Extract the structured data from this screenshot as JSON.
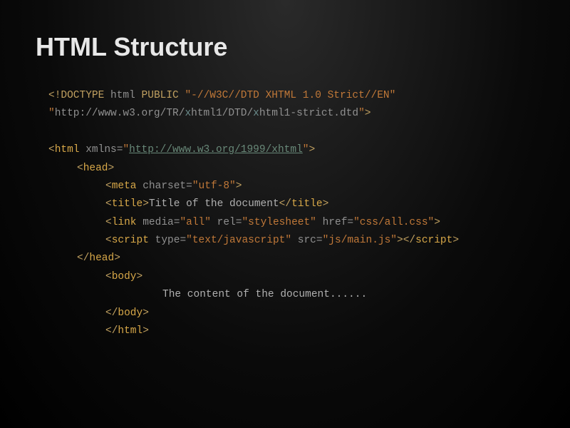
{
  "title": "HTML Structure",
  "code": {
    "doctype_open": "<!",
    "doctype_kw": "DOCTYPE",
    "doctype_sp1": " html ",
    "doctype_public": "PUBLIC",
    "doctype_sp2": " ",
    "doctype_fpi": "\"-//W3C//DTD XHTML 1.0 Strict//EN\"",
    "doctype_url_q1": "\"",
    "doctype_url_pre": "http://www.w3.org/TR/",
    "doctype_url_x1": "x",
    "doctype_url_mid1": "html1/DTD/",
    "doctype_url_x2": "x",
    "doctype_url_mid2": "html1-strict.dtd",
    "doctype_url_q2": "\"",
    "doctype_close": ">",
    "html_open_lt": "<",
    "html_tag": "html",
    "html_sp": " ",
    "html_xmlns": "xmlns",
    "html_eq": "=",
    "html_q1": "\"",
    "html_url": "http://www.w3.org/1999/xhtml",
    "html_q2": "\"",
    "html_gt": ">",
    "head_open": "<",
    "head_tag": "head",
    "head_gt": ">",
    "meta_open": "<",
    "meta_tag": "meta",
    "meta_sp": " ",
    "meta_attr": "charset",
    "meta_eq": "=",
    "meta_val": "\"utf-8\"",
    "meta_gt": ">",
    "title_open": "<",
    "title_tag": "title",
    "title_gt": ">",
    "title_text": "Title of the document",
    "title_close_open": "</",
    "title_close_tag": "title",
    "title_close_gt": ">",
    "link_open": "<",
    "link_tag": "link",
    "link_sp1": " ",
    "link_media": "media",
    "link_eq1": "=",
    "link_media_val": "\"all\"",
    "link_sp2": " ",
    "link_rel": "rel",
    "link_eq2": "=",
    "link_rel_val": "\"stylesheet\"",
    "link_sp3": " ",
    "link_href": "href",
    "link_eq3": "=",
    "link_href_val": "\"css/all.css\"",
    "link_gt": ">",
    "script_open": "<",
    "script_tag": "script",
    "script_sp1": " ",
    "script_type": "type",
    "script_eq1": "=",
    "script_type_val": "\"text/javascript\"",
    "script_sp2": " ",
    "script_src": "src",
    "script_eq2": "=",
    "script_src_val": "\"js/main.js\"",
    "script_gt": ">",
    "script_close_open": "</",
    "script_close_tag": "script",
    "script_close_gt": ">",
    "head_close_open": "</",
    "head_close_tag": "head",
    "head_close_gt": ">",
    "body_open": "<",
    "body_tag": "body",
    "body_gt": ">",
    "body_text": "The content of the document......",
    "body_close_open": "</",
    "body_close_tag": "body",
    "body_close_gt": ">",
    "html_close_open": "</",
    "html_close_tag": "html",
    "html_close_gt": ">"
  }
}
